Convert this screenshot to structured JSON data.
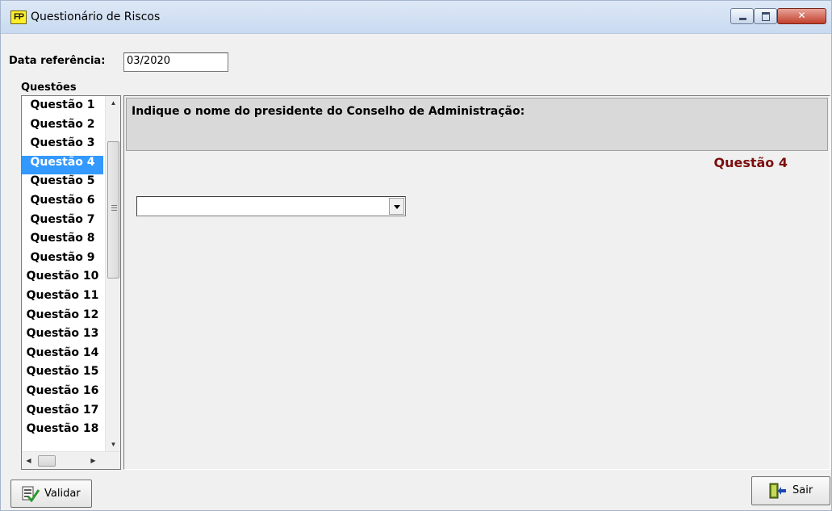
{
  "window": {
    "title": "Questionário de Riscos",
    "icon": "app-logo-icon",
    "icon_text": "FP"
  },
  "form": {
    "date_label": "Data referência:",
    "date_value": "03/2020",
    "questions_label": "Questões"
  },
  "questions": {
    "items": [
      "Questão 1",
      "Questão 2",
      "Questão 3",
      "Questão 4",
      "Questão 5",
      "Questão 6",
      "Questão 7",
      "Questão 8",
      "Questão 9",
      "Questão 10",
      "Questão 11",
      "Questão 12",
      "Questão 13",
      "Questão 14",
      "Questão 15",
      "Questão 16",
      "Questão 17",
      "Questão 18"
    ],
    "selected_index": 3
  },
  "detail": {
    "question_text": "Indique o nome do presidente do Conselho de Administração:",
    "question_number": "Questão 4",
    "answer_value": ""
  },
  "buttons": {
    "validate_label": "Validar",
    "exit_label": "Sair"
  },
  "colors": {
    "selection": "#3399ff",
    "question_number": "#7b0e0e"
  }
}
